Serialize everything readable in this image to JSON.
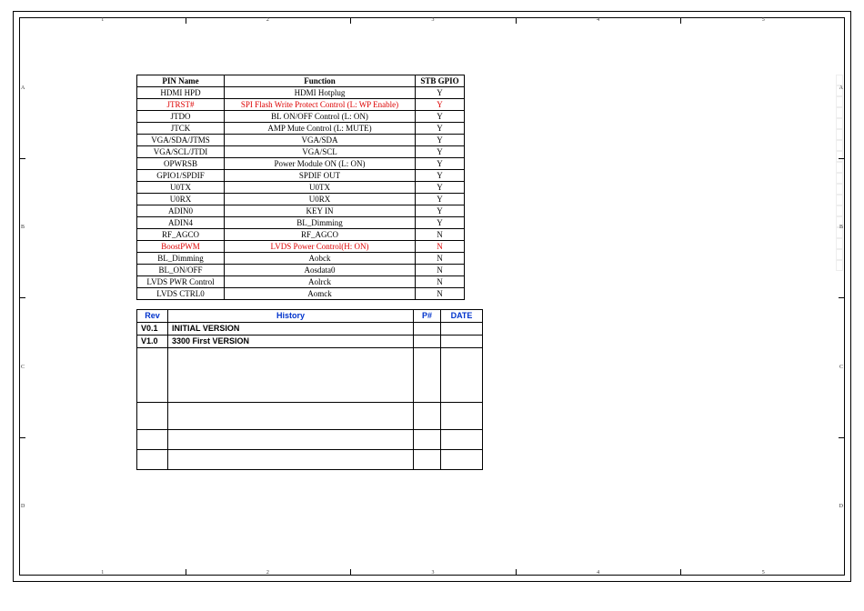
{
  "frame": {
    "h_ticks": [
      "1",
      "2",
      "3",
      "4",
      "5"
    ],
    "v_ticks": [
      "A",
      "B",
      "C",
      "D"
    ]
  },
  "pin_table": {
    "headers": {
      "pin": "PIN Name",
      "function": "Function",
      "gpio": "STB GPIO"
    },
    "rows": [
      {
        "pin": "HDMI HPD",
        "function": "HDMI Hotplug",
        "gpio": "Y",
        "red": false
      },
      {
        "pin": "JTRST#",
        "function": "SPI Flash Write Protect Control (L: WP Enable)",
        "gpio": "Y",
        "red": true
      },
      {
        "pin": "JTDO",
        "function": "BL ON/OFF Control (L: ON)",
        "gpio": "Y",
        "red": false
      },
      {
        "pin": "JTCK",
        "function": "AMP Mute Control (L: MUTE)",
        "gpio": "Y",
        "red": false
      },
      {
        "pin": "VGA/SDA/JTMS",
        "function": "VGA/SDA",
        "gpio": "Y",
        "red": false
      },
      {
        "pin": "VGA/SCL/JTDI",
        "function": "VGA/SCL",
        "gpio": "Y",
        "red": false
      },
      {
        "pin": "OPWRSB",
        "function": "Power Module ON (L: ON)",
        "gpio": "Y",
        "red": false
      },
      {
        "pin": "GPIO1/SPDIF",
        "function": "SPDIF OUT",
        "gpio": "Y",
        "red": false
      },
      {
        "pin": "U0TX",
        "function": "U0TX",
        "gpio": "Y",
        "red": false
      },
      {
        "pin": "U0RX",
        "function": "U0RX",
        "gpio": "Y",
        "red": false
      },
      {
        "pin": "ADIN0",
        "function": "KEY IN",
        "gpio": "Y",
        "red": false
      },
      {
        "pin": "ADIN4",
        "function": "BL_Dimming",
        "gpio": "Y",
        "red": false
      },
      {
        "pin": "RF_AGCO",
        "function": "RF_AGCO",
        "gpio": "N",
        "red": false
      },
      {
        "pin": "BoostPWM",
        "function": "LVDS Power Control(H: ON)",
        "gpio": "N",
        "red": true
      },
      {
        "pin": "BL_Dimming",
        "function": "Aobck",
        "gpio": "N",
        "red": false
      },
      {
        "pin": "BL_ON/OFF",
        "function": "Aosdata0",
        "gpio": "N",
        "red": false
      },
      {
        "pin": "LVDS PWR Control",
        "function": "Aolrck",
        "gpio": "N",
        "red": false
      },
      {
        "pin": "LVDS CTRL0",
        "function": "Aomck",
        "gpio": "N",
        "red": false
      }
    ]
  },
  "history_table": {
    "headers": {
      "rev": "Rev",
      "history": "History",
      "pn": "P#",
      "date": "DATE"
    },
    "rows": [
      {
        "rev": "V0.1",
        "history": "INITIAL VERSION",
        "pn": "",
        "date": "",
        "rowcls": ""
      },
      {
        "rev": "V1.0",
        "history": "3300 First VERSION",
        "pn": "",
        "date": "",
        "rowcls": ""
      },
      {
        "rev": "",
        "history": "",
        "pn": "",
        "date": "",
        "rowcls": "tall"
      },
      {
        "rev": "",
        "history": "",
        "pn": "",
        "date": "",
        "rowcls": "mid"
      },
      {
        "rev": "",
        "history": "",
        "pn": "",
        "date": "",
        "rowcls": "short"
      },
      {
        "rev": "",
        "history": "",
        "pn": "",
        "date": "",
        "rowcls": "short"
      }
    ]
  },
  "palette_swatches": [
    "#fff",
    "#fff",
    "#fff",
    "#fff",
    "#fff",
    "#fff",
    "#fff",
    "#fff",
    "#fff",
    "#fff",
    "#fff",
    "#fff",
    "#fff",
    "#fff",
    "#fff",
    "#fff",
    "#fff",
    "#fff"
  ]
}
